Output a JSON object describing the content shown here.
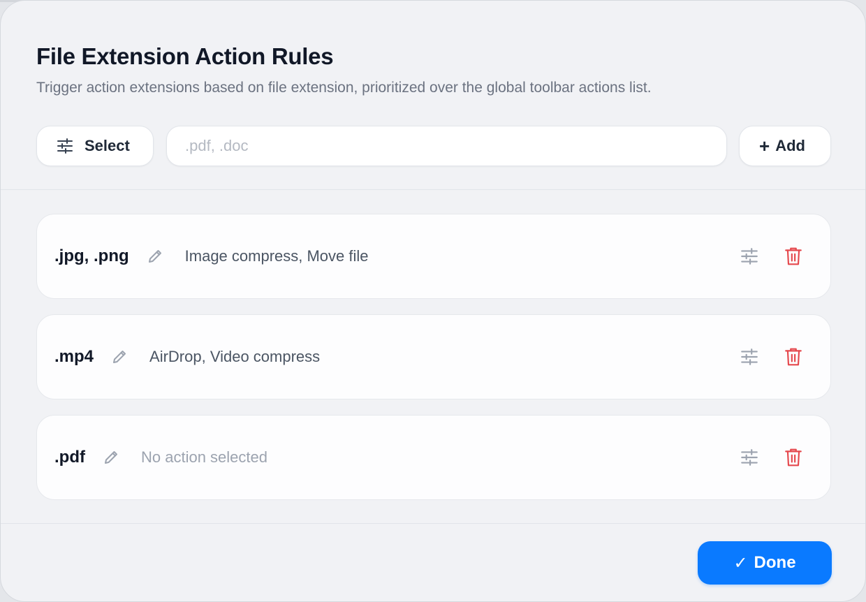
{
  "dialog": {
    "title": "File Extension Action Rules",
    "subtitle": "Trigger action extensions based on file extension, prioritized over the global toolbar actions list."
  },
  "toolbar": {
    "select_label": "Select",
    "select_icon": "sliders-icon",
    "extension_input": {
      "value": "",
      "placeholder": ".pdf, .doc"
    },
    "add_label": "Add",
    "add_icon": "+"
  },
  "rules": [
    {
      "extensions": ".jpg, .png",
      "actions": "Image compress, Move file"
    },
    {
      "extensions": ".mp4",
      "actions": "AirDrop, Video compress"
    },
    {
      "extensions": ".pdf",
      "actions": "No action selected"
    }
  ],
  "footer": {
    "done_label": "Done",
    "done_icon": "✓"
  },
  "colors": {
    "accent": "#0a7aff",
    "delete": "#e5484d",
    "icon_muted": "#9ca3af"
  }
}
